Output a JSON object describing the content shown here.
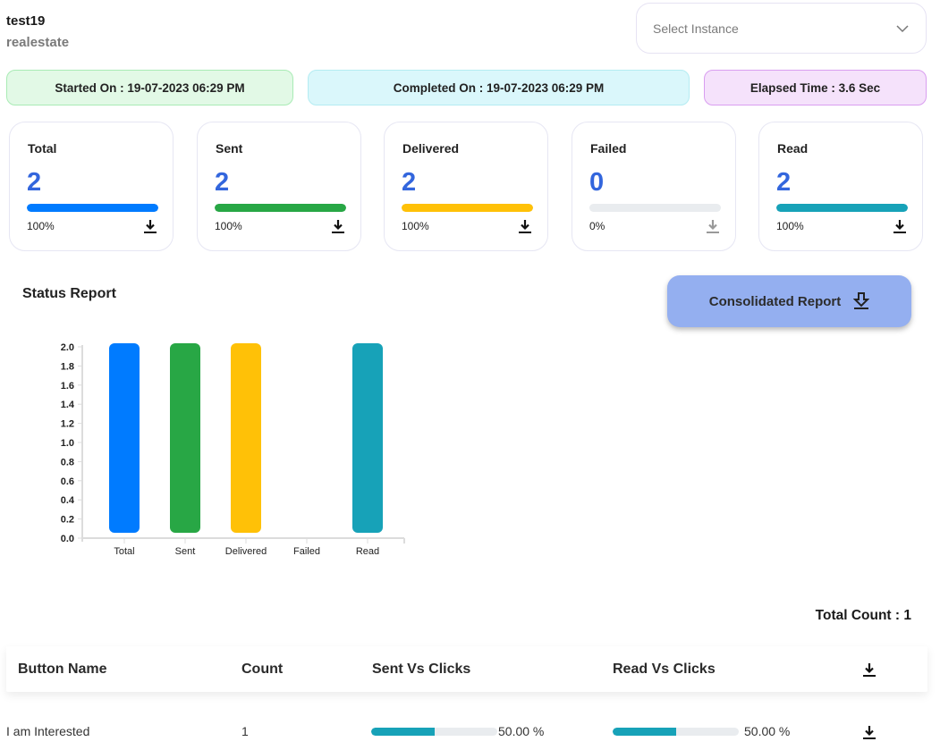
{
  "header": {
    "title": "test19",
    "subtitle": "realestate",
    "instance_select": {
      "placeholder": "Select Instance"
    }
  },
  "info": {
    "started": "Started On : 19-07-2023 06:29 PM",
    "completed": "Completed On : 19-07-2023 06:29 PM",
    "elapsed": "Elapsed Time : 3.6 Sec"
  },
  "stats": [
    {
      "label": "Total",
      "value": "2",
      "percent": 100,
      "percent_label": "100%",
      "color": "#007bff",
      "download_enabled": true
    },
    {
      "label": "Sent",
      "value": "2",
      "percent": 100,
      "percent_label": "100%",
      "color": "#28a745",
      "download_enabled": true
    },
    {
      "label": "Delivered",
      "value": "2",
      "percent": 100,
      "percent_label": "100%",
      "color": "#ffc107",
      "download_enabled": true
    },
    {
      "label": "Failed",
      "value": "0",
      "percent": 0,
      "percent_label": "0%",
      "color": "#dc3545",
      "download_enabled": false
    },
    {
      "label": "Read",
      "value": "2",
      "percent": 100,
      "percent_label": "100%",
      "color": "#17a2b8",
      "download_enabled": true
    }
  ],
  "status_report": {
    "title": "Status Report",
    "consolidated_label": "Consolidated Report"
  },
  "chart_data": {
    "type": "bar",
    "title": "Status Report",
    "categories": [
      "Total",
      "Sent",
      "Delivered",
      "Failed",
      "Read"
    ],
    "values": [
      2,
      2,
      2,
      0,
      2
    ],
    "colors": [
      "#007bff",
      "#28a745",
      "#ffc107",
      "#dc3545",
      "#17a2b8"
    ],
    "xlabel": "",
    "ylabel": "",
    "ylim": [
      0,
      2.0
    ],
    "yticks": [
      "0.0",
      "0.2",
      "0.4",
      "0.6",
      "0.8",
      "1.0",
      "1.2",
      "1.4",
      "1.6",
      "1.8",
      "2.0"
    ],
    "grid": false,
    "legend": "none"
  },
  "buttons_table": {
    "total_count": "Total Count : 1",
    "columns": [
      "Button Name",
      "Count",
      "Sent Vs Clicks",
      "Read Vs Clicks"
    ],
    "rows": [
      {
        "name": "I am Interested",
        "count": "1",
        "sent_vs_clicks": 50,
        "sent_vs_clicks_label": "50.00 %",
        "read_vs_clicks": 50,
        "read_vs_clicks_label": "50.00 %"
      }
    ]
  }
}
